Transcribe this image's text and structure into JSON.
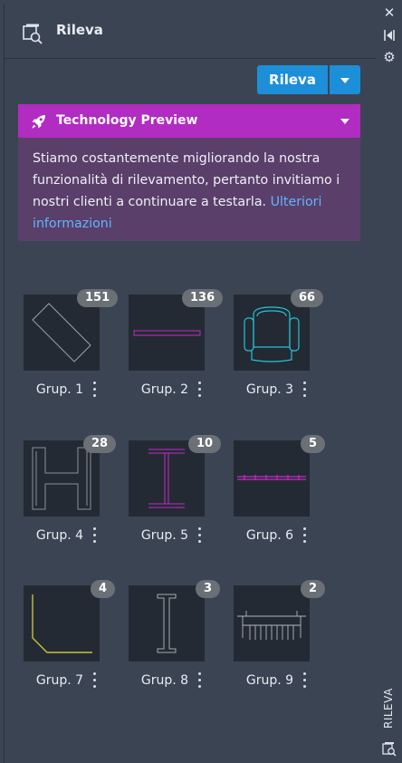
{
  "header": {
    "title": "Rileva",
    "icon": "rileva-icon"
  },
  "toolbar": {
    "rileva_label": "Rileva"
  },
  "right_bar": {
    "label": "RILEVA"
  },
  "preview": {
    "title": "Technology Preview",
    "text": "Stiamo costantemente migliorando la nostra funzionalità di rilevamento, pertanto invitiamo i nostri clienti a continuare a testarla.",
    "link": "Ulteriori informazioni",
    "accent": "#b12cc0"
  },
  "groups": [
    {
      "name": "Grup. 1",
      "count": "151"
    },
    {
      "name": "Grup. 2",
      "count": "136"
    },
    {
      "name": "Grup. 3",
      "count": "66"
    },
    {
      "name": "Grup. 4",
      "count": "28"
    },
    {
      "name": "Grup. 5",
      "count": "10"
    },
    {
      "name": "Grup. 6",
      "count": "5"
    },
    {
      "name": "Grup. 7",
      "count": "4"
    },
    {
      "name": "Grup. 8",
      "count": "3"
    },
    {
      "name": "Grup. 9",
      "count": "2"
    }
  ]
}
